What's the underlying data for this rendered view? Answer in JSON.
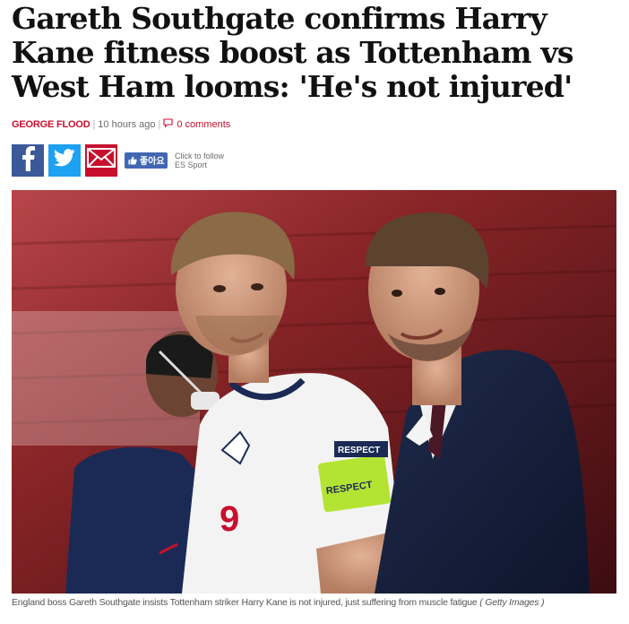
{
  "article": {
    "headline": "Gareth Southgate confirms Harry Kane fitness boost as Tottenham vs West Ham looms: 'He's not injured'",
    "author": "GEORGE FLOOD",
    "published": "10 hours ago",
    "comments": "0 comments"
  },
  "share": {
    "like_label": "좋아요",
    "follow_line1": "Click to follow",
    "follow_line2": "ES Sport"
  },
  "image": {
    "armband_patch": "RESPECT",
    "armband_band": "RESPECT",
    "shirt_number": "9"
  },
  "caption": {
    "text": "England boss Gareth Southgate insists Tottenham striker Harry Kane is not injured, just suffering from muscle fatigue",
    "credit": "( Getty Images )"
  },
  "colors": {
    "accent": "#c8102e",
    "facebook": "#3b5998",
    "twitter": "#1da1f2",
    "like": "#4267b2"
  }
}
